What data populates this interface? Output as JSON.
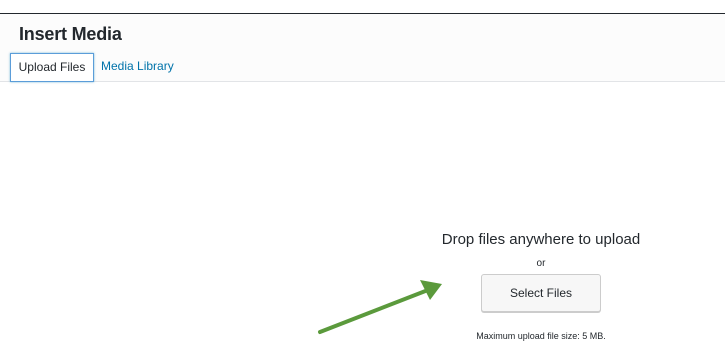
{
  "modal": {
    "title": "Insert Media"
  },
  "tabs": [
    {
      "label": "Upload Files",
      "active": true
    },
    {
      "label": "Media Library",
      "active": false
    }
  ],
  "uploader": {
    "drop_text": "Drop files anywhere to upload",
    "or_text": "or",
    "select_button_label": "Select Files",
    "max_size_text": "Maximum upload file size: 5 MB."
  },
  "colors": {
    "link": "#0073aa",
    "arrow": "#5b9a3c",
    "text": "#23282d"
  }
}
